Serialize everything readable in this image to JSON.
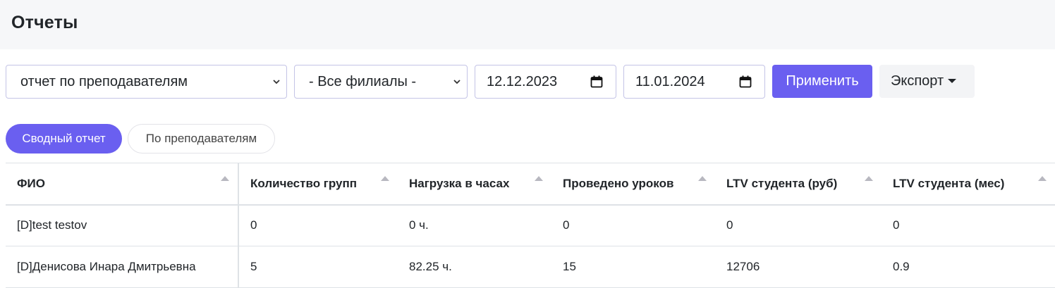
{
  "header": {
    "title": "Отчеты"
  },
  "filters": {
    "report_type": "отчет по преподавателям",
    "branch": "- Все филиалы -",
    "date_from": "12.12.2023",
    "date_to": "11.01.2024",
    "apply_label": "Применить",
    "export_label": "Экспорт"
  },
  "tabs": [
    {
      "label": "Сводный отчет",
      "active": true
    },
    {
      "label": "По преподавателям",
      "active": false
    }
  ],
  "table": {
    "columns": [
      "ФИО",
      "Количество групп",
      "Нагрузка в часах",
      "Проведено уроков",
      "LTV студента (руб)",
      "LTV студента (мес)"
    ],
    "rows": [
      [
        "[D]test testov",
        "0",
        "0 ч.",
        "0",
        "0",
        "0"
      ],
      [
        "[D]Денисова Инара Дмитрьевна",
        "5",
        "82.25 ч.",
        "15",
        "12706",
        "0.9"
      ]
    ]
  },
  "colors": {
    "accent": "#6a5ff0",
    "header_bg": "#f6f7f9",
    "border": "#dee2e6"
  }
}
